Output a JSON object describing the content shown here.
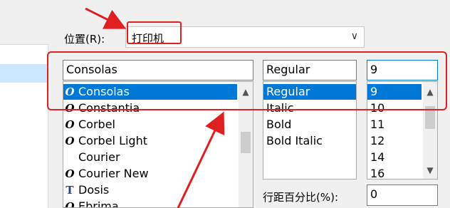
{
  "location": {
    "label": "位置(R):",
    "value": "打印机",
    "chevron_icon": "chevron-down-icon"
  },
  "font": {
    "value": "Consolas",
    "items": [
      {
        "label": "Consolas",
        "icon": "opentype-font-icon",
        "glyph": "O",
        "selected": true
      },
      {
        "label": "Constantia",
        "icon": "opentype-font-icon",
        "glyph": "O"
      },
      {
        "label": "Corbel",
        "icon": "opentype-font-icon",
        "glyph": "O"
      },
      {
        "label": "Corbel Light",
        "icon": "opentype-font-icon",
        "glyph": "O"
      },
      {
        "label": "Courier",
        "icon": "",
        "glyph": ""
      },
      {
        "label": "Courier New",
        "icon": "opentype-font-icon",
        "glyph": "O"
      },
      {
        "label": "Dosis",
        "icon": "truetype-font-icon",
        "glyph": "T"
      },
      {
        "label": "Ebrima",
        "icon": "opentype-font-icon",
        "glyph": "O"
      }
    ]
  },
  "style": {
    "value": "Regular",
    "items": [
      {
        "label": "Regular",
        "selected": true
      },
      {
        "label": "Italic"
      },
      {
        "label": "Bold"
      },
      {
        "label": "Bold Italic"
      }
    ]
  },
  "size": {
    "value": "9",
    "items": [
      {
        "label": "9",
        "selected": true
      },
      {
        "label": "10"
      },
      {
        "label": "11"
      },
      {
        "label": "12"
      },
      {
        "label": "14"
      },
      {
        "label": "16"
      }
    ]
  },
  "spacing": {
    "label": "行距百分比(%):",
    "value": "0"
  },
  "colors": {
    "annotation": "#e02020",
    "selection": "#0078d7",
    "left_highlight": "#cce8ff"
  }
}
